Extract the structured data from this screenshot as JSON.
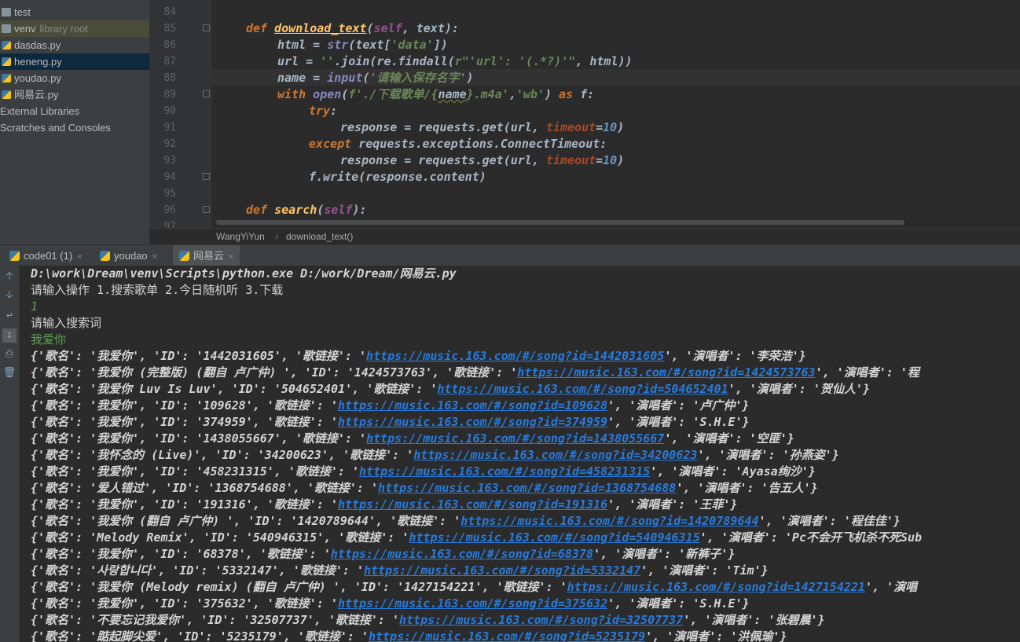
{
  "project_tree": [
    {
      "label": "test",
      "type": "folder"
    },
    {
      "label": "venv",
      "sub": "library root",
      "type": "folder"
    },
    {
      "label": "dasdas.py",
      "type": "py"
    },
    {
      "label": "heneng.py",
      "type": "py"
    },
    {
      "label": "youdao.py",
      "type": "py"
    },
    {
      "label": "网易云.py",
      "type": "py"
    },
    {
      "label": "External Libraries",
      "type": "plain"
    },
    {
      "label": "Scratches and Consoles",
      "type": "plain"
    }
  ],
  "editor": {
    "line_numbers": [
      "84",
      "85",
      "86",
      "87",
      "88",
      "89",
      "90",
      "91",
      "92",
      "93",
      "94",
      "95",
      "96",
      "97"
    ],
    "lines": {
      "l85": {
        "kw": "def ",
        "fn": "download_text",
        "p1": "(",
        "self": "self",
        "p2": ", text):"
      },
      "l86": {
        "a": "html = ",
        "bi": "str",
        "b": "(text[",
        "s": "'data'",
        "c": "])"
      },
      "l87": {
        "a": "url = ",
        "s1": "''",
        "b": ".join(re.findall(",
        "s2": "r\"'url': '(.*?)'\"",
        "c": ", html))"
      },
      "l88": {
        "a": "name = ",
        "bi": "input",
        "b": "(",
        "s": "'请输入保存名字'",
        "c": ")"
      },
      "l89": {
        "kw": "with ",
        "bi": "open",
        "b": "(",
        "s1": "f'./下载歌单/{",
        "v": "name",
        "s2": "}.m4a'",
        "c": ",",
        "s3": "'wb'",
        "d": ") ",
        "kw2": "as",
        "e": " f:"
      },
      "l90": {
        "kw": "try",
        "a": ":"
      },
      "l91": {
        "a": "response = requests.get(url, ",
        "param": "timeout",
        "b": "=",
        "num": "10",
        "c": ")"
      },
      "l92": {
        "kw": "except ",
        "a": "requests.exceptions.ConnectTimeout:"
      },
      "l93": {
        "a": "response = requests.get(url, ",
        "param": "timeout",
        "b": "=",
        "num": "10",
        "c": ")"
      },
      "l94": {
        "a": "f.write(response.content)"
      },
      "l96": {
        "kw": "def ",
        "fn": "search",
        "p1": "(",
        "self": "self",
        "p2": "):"
      }
    }
  },
  "breadcrumb": {
    "cls": "WangYiYun",
    "sep": "›",
    "method": "download_text()"
  },
  "run_tabs": [
    {
      "label": "code01 (1)",
      "close": "×"
    },
    {
      "label": "youdao",
      "close": "×"
    },
    {
      "label": "网易云",
      "close": "×"
    }
  ],
  "console": {
    "cmd": "D:\\work\\Dream\\venv\\Scripts\\python.exe D:/work/Dream/网易云.py",
    "prompt1": "请输入操作 1.搜索歌单 2.今日随机听 3.下载",
    "input1": "1",
    "prompt2": "请输入搜索词",
    "input2": "我爱你",
    "results": [
      {
        "pre": "{'歌名': '我爱你', 'ID': '1442031605', '歌链接': '",
        "url": "https://music.163.com/#/song?id=1442031605",
        "post": "', '演唱者': '李荣浩'}"
      },
      {
        "pre": "{'歌名': '我爱你 (完整版) (翻自 卢广仲) ', 'ID': '1424573763', '歌链接': '",
        "url": "https://music.163.com/#/song?id=1424573763",
        "post": "', '演唱者': '程"
      },
      {
        "pre": "{'歌名': '我爱你 Luv Is Luv', 'ID': '504652401', '歌链接': '",
        "url": "https://music.163.com/#/song?id=504652401",
        "post": "', '演唱者': '贺仙人'}"
      },
      {
        "pre": "{'歌名': '我爱你', 'ID': '109628', '歌链接': '",
        "url": "https://music.163.com/#/song?id=109628",
        "post": "', '演唱者': '卢广仲'}"
      },
      {
        "pre": "{'歌名': '我爱你', 'ID': '374959', '歌链接': '",
        "url": "https://music.163.com/#/song?id=374959",
        "post": "', '演唱者': 'S.H.E'}"
      },
      {
        "pre": "{'歌名': '我爱你', 'ID': '1438055667', '歌链接': '",
        "url": "https://music.163.com/#/song?id=1438055667",
        "post": "', '演唱者': '空匪'}"
      },
      {
        "pre": "{'歌名': '我怀念的 (Live)', 'ID': '34200623', '歌链接': '",
        "url": "https://music.163.com/#/song?id=34200623",
        "post": "', '演唱者': '孙燕姿'}"
      },
      {
        "pre": "{'歌名': '我爱你', 'ID': '458231315', '歌链接': '",
        "url": "https://music.163.com/#/song?id=458231315",
        "post": "', '演唱者': 'Ayasa绚沙'}"
      },
      {
        "pre": "{'歌名': '爱人错过', 'ID': '1368754688', '歌链接': '",
        "url": "https://music.163.com/#/song?id=1368754688",
        "post": "', '演唱者': '告五人'}"
      },
      {
        "pre": "{'歌名': '我爱你', 'ID': '191316', '歌链接': '",
        "url": "https://music.163.com/#/song?id=191316",
        "post": "', '演唱者': '王菲'}"
      },
      {
        "pre": "{'歌名': '我爱你 (翻自 卢广仲) ', 'ID': '1420789644', '歌链接': '",
        "url": "https://music.163.com/#/song?id=1420789644",
        "post": "', '演唱者': '程佳佳'}"
      },
      {
        "pre": "{'歌名': 'Melody Remix', 'ID': '540946315', '歌链接': '",
        "url": "https://music.163.com/#/song?id=540946315",
        "post": "', '演唱者': 'Pc不会开飞机杀不死Sub"
      },
      {
        "pre": "{'歌名': '我爱你', 'ID': '68378', '歌链接': '",
        "url": "https://music.163.com/#/song?id=68378",
        "post": "', '演唱者': '新裤子'}"
      },
      {
        "pre": "{'歌名': '사랑합니다', 'ID': '5332147', '歌链接': '",
        "url": "https://music.163.com/#/song?id=5332147",
        "post": "', '演唱者': 'Tim'}"
      },
      {
        "pre": "{'歌名': '我爱你 (Melody remix) (翻自 卢广仲) ', 'ID': '1427154221', '歌链接': '",
        "url": "https://music.163.com/#/song?id=1427154221",
        "post": "', '演唱"
      },
      {
        "pre": "{'歌名': '我爱你', 'ID': '375632', '歌链接': '",
        "url": "https://music.163.com/#/song?id=375632",
        "post": "', '演唱者': 'S.H.E'}"
      },
      {
        "pre": "{'歌名': '不要忘记我爱你', 'ID': '32507737', '歌链接': '",
        "url": "https://music.163.com/#/song?id=32507737",
        "post": "', '演唱者': '张碧晨'}"
      },
      {
        "pre": "{'歌名': '踮起脚尖爱', 'ID': '5235179', '歌链接': '",
        "url": "https://music.163.com/#/song?id=5235179",
        "post": "', '演唱者': '洪佩瑜'}"
      }
    ]
  },
  "colors": {
    "keyword": "#cc7832",
    "function": "#ffc66d",
    "string": "#6a8759",
    "number": "#6897bb",
    "link": "#287bde",
    "input": "#5fa04e"
  }
}
